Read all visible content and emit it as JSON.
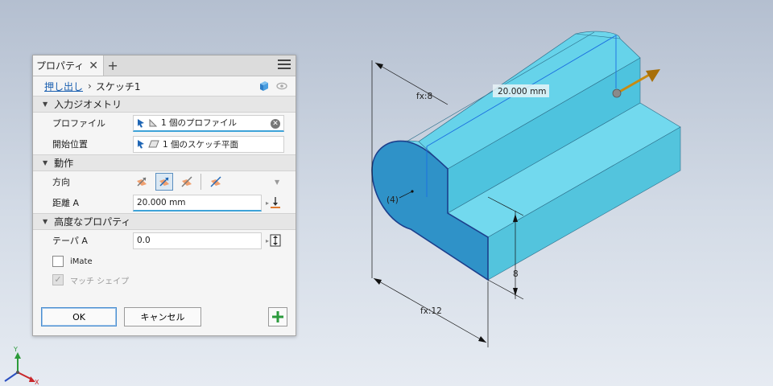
{
  "panel": {
    "tab_label": "プロパティ",
    "tab_close": "✕",
    "tab_add": "+",
    "breadcrumb_link": "押し出し",
    "breadcrumb_sep": "›",
    "breadcrumb_current": "スケッチ1",
    "sections": {
      "input_geometry": "入力ジオメトリ",
      "behavior": "動作",
      "advanced": "高度なプロパティ"
    },
    "profile_label": "プロファイル",
    "profile_value": "1 個のプロファイル",
    "start_label": "開始位置",
    "start_value": "1 個のスケッチ平面",
    "direction_label": "方向",
    "distance_label": "距離 A",
    "distance_value": "20.000 mm",
    "taper_label": "テーパ A",
    "taper_value": "0.0",
    "imate_label": "iMate",
    "match_shape_label": "マッチ シェイプ",
    "ok_label": "OK",
    "cancel_label": "キャンセル"
  },
  "dimensions": {
    "length": "20.000 mm",
    "height": "fx:8",
    "width": "fx:12",
    "step": "8",
    "radius": "(4)"
  },
  "triad": {
    "y": "Y",
    "x": "X"
  },
  "colors": {
    "part_top": "#6ad6ec",
    "part_side": "#3fb8d6",
    "profile": "#2e8fc6",
    "accent": "#3ea3d8",
    "arrow": "#c88a10"
  }
}
